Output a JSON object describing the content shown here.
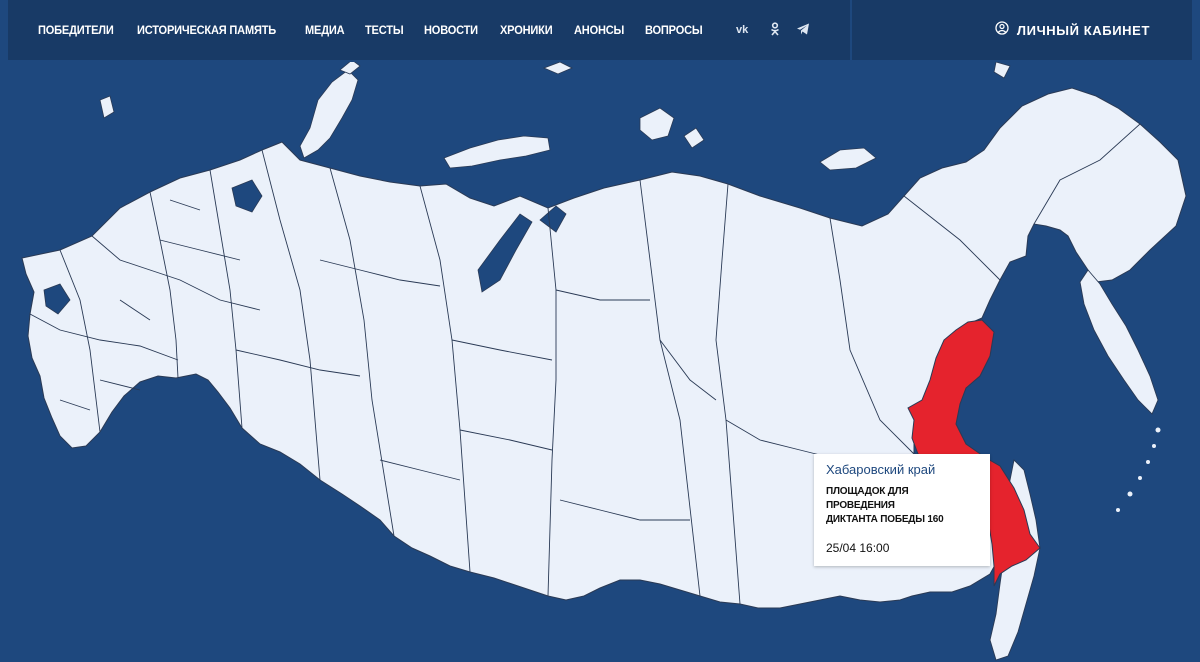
{
  "nav": {
    "items": [
      "ПОБЕДИТЕЛИ",
      "ИСТОРИЧЕСКАЯ ПАМЯТЬ",
      "МЕДИА",
      "ТЕСТЫ",
      "НОВОСТИ",
      "ХРОНИКИ",
      "АНОНСЫ",
      "ВОПРОСЫ"
    ]
  },
  "social": {
    "icons": [
      "vk-icon",
      "odnoklassniki-icon",
      "telegram-icon"
    ]
  },
  "cabinet": {
    "label": "ЛИЧНЫЙ КАБИНЕТ",
    "icon": "user-circle-icon"
  },
  "map": {
    "highlighted_region": "Хабаровский край",
    "colors": {
      "sea": "#1e487e",
      "land": "#ebf1fa",
      "border": "#2a3a55",
      "highlight": "#e5232d"
    }
  },
  "tooltip": {
    "region": "Хабаровский край",
    "caption_line1": "ПЛОЩАДОК ДЛЯ ПРОВЕДЕНИЯ",
    "caption_line2": "ДИКТАНТА ПОБЕДЫ 160",
    "datetime": "25/04 16:00"
  }
}
